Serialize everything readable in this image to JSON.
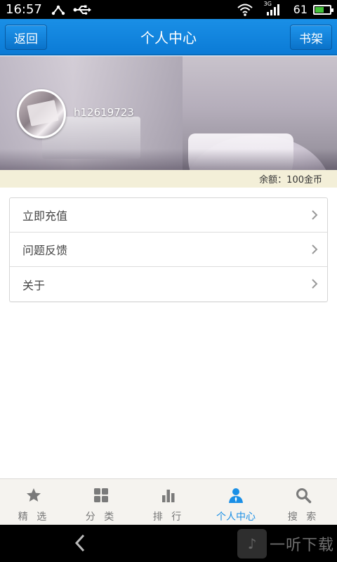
{
  "status_bar": {
    "time": "16:57",
    "network_badge": "3G",
    "battery_percent": "61",
    "battery_level": 0.61
  },
  "header": {
    "title": "个人中心",
    "back_label": "返回",
    "bookshelf_label": "书架"
  },
  "profile": {
    "username": "h12619723",
    "balance_text": "余额：100金币"
  },
  "menu": {
    "items": [
      {
        "label": "立即充值"
      },
      {
        "label": "问题反馈"
      },
      {
        "label": "关于"
      }
    ]
  },
  "bottom_nav": {
    "items": [
      {
        "label": "精 选",
        "icon": "star-icon",
        "active": false
      },
      {
        "label": "分 类",
        "icon": "grid-icon",
        "active": false
      },
      {
        "label": "排 行",
        "icon": "bar-chart-icon",
        "active": false
      },
      {
        "label": "个人中心",
        "icon": "person-icon",
        "active": true
      },
      {
        "label": "搜 索",
        "icon": "search-icon",
        "active": false
      }
    ]
  },
  "watermark": {
    "text": "一听下载"
  },
  "colors": {
    "accent": "#1a8fe6",
    "balance_bg": "#f3efd8",
    "nav_bg": "#f5f3ef"
  }
}
